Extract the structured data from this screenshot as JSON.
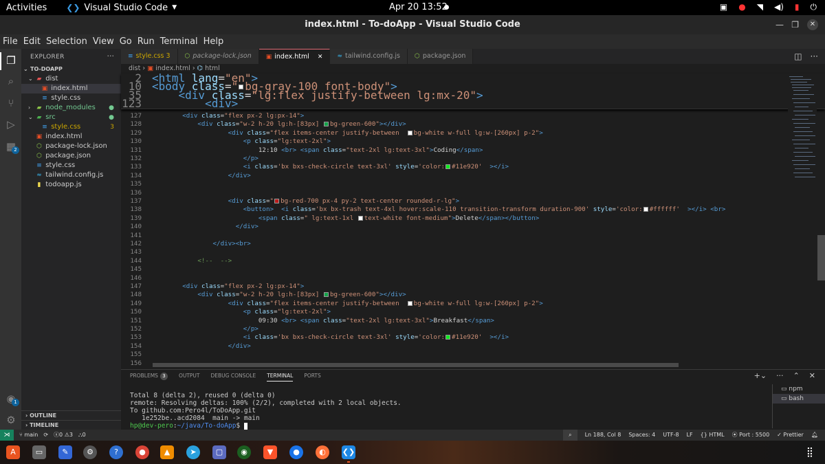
{
  "gnome": {
    "activities": "Activities",
    "app_name": "Visual Studio Code",
    "clock": "Apr 20  13:52"
  },
  "window": {
    "title": "index.html - To-doApp - Visual Studio Code"
  },
  "menu": [
    "File",
    "Edit",
    "Selection",
    "View",
    "Go",
    "Run",
    "Terminal",
    "Help"
  ],
  "activity": {
    "extensions_badge": "2",
    "accounts_badge": "1"
  },
  "sidebar": {
    "header": "EXPLORER",
    "root": "TO-DOAPP",
    "items": [
      {
        "label": "dist",
        "status": ""
      },
      {
        "label": "index.html",
        "status": ""
      },
      {
        "label": "style.css",
        "status": ""
      },
      {
        "label": "node_modules",
        "status": "●"
      },
      {
        "label": "src",
        "status": "●"
      },
      {
        "label": "style.css",
        "status": "3"
      },
      {
        "label": "index.html",
        "status": ""
      },
      {
        "label": "package-lock.json",
        "status": ""
      },
      {
        "label": "package.json",
        "status": ""
      },
      {
        "label": "style.css",
        "status": ""
      },
      {
        "label": "tailwind.config.js",
        "status": ""
      },
      {
        "label": "todoapp.js",
        "status": ""
      }
    ],
    "outline": "OUTLINE",
    "timeline": "TIMELINE"
  },
  "tabs": [
    {
      "label": "style.css 3"
    },
    {
      "label": "package-lock.json"
    },
    {
      "label": "index.html"
    },
    {
      "label": "tailwind.config.js"
    },
    {
      "label": "package.json"
    }
  ],
  "breadcrumb": {
    "a": "dist",
    "b": "index.html",
    "c": "html"
  },
  "sticky": [
    {
      "n": "2",
      "parts": [
        [
          "tg",
          "<html "
        ],
        [
          "at",
          "lang"
        ],
        [
          "eq",
          "="
        ],
        [
          "sv",
          "\"en\""
        ],
        [
          "tg",
          ">"
        ]
      ]
    },
    {
      "n": "10",
      "parts": [
        [
          "tg",
          "<body "
        ],
        [
          "at",
          "class"
        ],
        [
          "eq",
          "="
        ],
        [
          "sv",
          "\""
        ],
        [
          "sw",
          "#ffffff"
        ],
        [
          "sv",
          "bg-gray-100 font-body\""
        ],
        [
          "tg",
          ">"
        ]
      ]
    },
    {
      "n": "35",
      "parts": [
        [
          "tx",
          "    "
        ],
        [
          "tg",
          "<div "
        ],
        [
          "at",
          "class"
        ],
        [
          "eq",
          "="
        ],
        [
          "sv",
          "\"lg:flex justify-between lg:mx-20\""
        ],
        [
          "tg",
          ">"
        ]
      ]
    },
    {
      "n": "123",
      "parts": [
        [
          "tx",
          "        "
        ],
        [
          "tg",
          "<div>"
        ]
      ]
    }
  ],
  "code": [
    {
      "n": "127",
      "parts": [
        [
          "tx",
          "        "
        ],
        [
          "tg",
          "<div "
        ],
        [
          "at",
          "class"
        ],
        [
          "eq",
          "="
        ],
        [
          "sv",
          "\"flex px-2 lg:px-14\""
        ],
        [
          "tg",
          ">"
        ]
      ]
    },
    {
      "n": "128",
      "parts": [
        [
          "tx",
          "            "
        ],
        [
          "tg",
          "<div "
        ],
        [
          "at",
          "class"
        ],
        [
          "eq",
          "="
        ],
        [
          "sv",
          "\"w-2 h-20 lg:h-[83px] "
        ],
        [
          "sw",
          "#16a34a"
        ],
        [
          "sv",
          "bg-green-600\""
        ],
        [
          "tg",
          "></div>"
        ]
      ]
    },
    {
      "n": "129",
      "parts": [
        [
          "tx",
          "                    "
        ],
        [
          "tg",
          "<div "
        ],
        [
          "at",
          "class"
        ],
        [
          "eq",
          "="
        ],
        [
          "sv",
          "\"flex items-center justify-between  "
        ],
        [
          "sw",
          "#ffffff"
        ],
        [
          "sv",
          "bg-white w-full lg:w-[260px] p-2\""
        ],
        [
          "tg",
          ">"
        ]
      ]
    },
    {
      "n": "130",
      "parts": [
        [
          "tx",
          "                        "
        ],
        [
          "tg",
          "<p "
        ],
        [
          "at",
          "class"
        ],
        [
          "eq",
          "="
        ],
        [
          "sv",
          "\"lg:text-2xl\""
        ],
        [
          "tg",
          ">"
        ]
      ]
    },
    {
      "n": "131",
      "parts": [
        [
          "tx",
          "                            12:10 "
        ],
        [
          "tg",
          "<br>"
        ],
        [
          "tx",
          " "
        ],
        [
          "tg",
          "<span "
        ],
        [
          "at",
          "class"
        ],
        [
          "eq",
          "="
        ],
        [
          "sv",
          "\"text-2xl lg:text-3xl\""
        ],
        [
          "tg",
          ">"
        ],
        [
          "tx",
          "Coding"
        ],
        [
          "tg",
          "</span>"
        ]
      ]
    },
    {
      "n": "132",
      "parts": [
        [
          "tx",
          "                        "
        ],
        [
          "tg",
          "</p>"
        ]
      ]
    },
    {
      "n": "133",
      "parts": [
        [
          "tx",
          "                        "
        ],
        [
          "tg",
          "<i "
        ],
        [
          "at",
          "class"
        ],
        [
          "eq",
          "="
        ],
        [
          "sv",
          "'bx bxs-check-circle text-3xl' "
        ],
        [
          "at",
          "style"
        ],
        [
          "eq",
          "="
        ],
        [
          "sv",
          "'color:"
        ],
        [
          "sw",
          "#11e920"
        ],
        [
          "sv",
          "#11e920'"
        ],
        [
          "tx",
          "  "
        ],
        [
          "tg",
          "></i>"
        ]
      ]
    },
    {
      "n": "134",
      "parts": [
        [
          "tx",
          "                    "
        ],
        [
          "tg",
          "</div>"
        ]
      ]
    },
    {
      "n": "135",
      "parts": []
    },
    {
      "n": "136",
      "parts": []
    },
    {
      "n": "137",
      "parts": [
        [
          "tx",
          "                    "
        ],
        [
          "tg",
          "<div "
        ],
        [
          "at",
          "class"
        ],
        [
          "eq",
          "="
        ],
        [
          "sv",
          "\""
        ],
        [
          "sw",
          "#b91c1c"
        ],
        [
          "sv",
          "bg-red-700 px-4 py-2 text-center rounded-r-lg\""
        ],
        [
          "tg",
          ">"
        ]
      ]
    },
    {
      "n": "138",
      "parts": [
        [
          "tx",
          "                        "
        ],
        [
          "tg",
          "<button>"
        ],
        [
          "tx",
          "  "
        ],
        [
          "tg",
          "<i "
        ],
        [
          "at",
          "class"
        ],
        [
          "eq",
          "="
        ],
        [
          "sv",
          "'bx bx-trash text-4xl hover:scale-110 transition-transform duration-900' "
        ],
        [
          "at",
          "style"
        ],
        [
          "eq",
          "="
        ],
        [
          "sv",
          "'color:"
        ],
        [
          "sw",
          "#ffffff"
        ],
        [
          "sv",
          "#ffffff'"
        ],
        [
          "tx",
          "  "
        ],
        [
          "tg",
          "></i>"
        ],
        [
          "tx",
          " "
        ],
        [
          "tg",
          "<br>"
        ]
      ]
    },
    {
      "n": "139",
      "parts": [
        [
          "tx",
          "                            "
        ],
        [
          "tg",
          "<span "
        ],
        [
          "at",
          "class"
        ],
        [
          "eq",
          "="
        ],
        [
          "sv",
          "\" lg:text-1xl "
        ],
        [
          "sw",
          "#ffffff"
        ],
        [
          "sv",
          "text-white font-medium\""
        ],
        [
          "tg",
          ">"
        ],
        [
          "tx",
          "Delete"
        ],
        [
          "tg",
          "</span></button>"
        ]
      ]
    },
    {
      "n": "140",
      "parts": [
        [
          "tx",
          "                      "
        ],
        [
          "tg",
          "</div>"
        ]
      ]
    },
    {
      "n": "141",
      "parts": []
    },
    {
      "n": "142",
      "parts": [
        [
          "tx",
          "                "
        ],
        [
          "tg",
          "</div><br>"
        ]
      ]
    },
    {
      "n": "143",
      "parts": []
    },
    {
      "n": "144",
      "parts": [
        [
          "tx",
          "            "
        ],
        [
          "cm",
          "<!--  -->"
        ]
      ]
    },
    {
      "n": "145",
      "parts": []
    },
    {
      "n": "146",
      "parts": []
    },
    {
      "n": "147",
      "parts": [
        [
          "tx",
          "        "
        ],
        [
          "tg",
          "<div "
        ],
        [
          "at",
          "class"
        ],
        [
          "eq",
          "="
        ],
        [
          "sv",
          "\"flex px-2 lg:px-14\""
        ],
        [
          "tg",
          ">"
        ]
      ]
    },
    {
      "n": "148",
      "parts": [
        [
          "tx",
          "            "
        ],
        [
          "tg",
          "<div "
        ],
        [
          "at",
          "class"
        ],
        [
          "eq",
          "="
        ],
        [
          "sv",
          "\"w-2 h-20 lg:h-[83px] "
        ],
        [
          "sw",
          "#16a34a"
        ],
        [
          "sv",
          "bg-green-600\""
        ],
        [
          "tg",
          "></div>"
        ]
      ]
    },
    {
      "n": "149",
      "parts": [
        [
          "tx",
          "                    "
        ],
        [
          "tg",
          "<div "
        ],
        [
          "at",
          "class"
        ],
        [
          "eq",
          "="
        ],
        [
          "sv",
          "\"flex items-center justify-between  "
        ],
        [
          "sw",
          "#ffffff"
        ],
        [
          "sv",
          "bg-white w-full lg:w-[260px] p-2\""
        ],
        [
          "tg",
          ">"
        ]
      ]
    },
    {
      "n": "150",
      "parts": [
        [
          "tx",
          "                        "
        ],
        [
          "tg",
          "<p "
        ],
        [
          "at",
          "class"
        ],
        [
          "eq",
          "="
        ],
        [
          "sv",
          "\"lg:text-2xl\""
        ],
        [
          "tg",
          ">"
        ]
      ]
    },
    {
      "n": "151",
      "parts": [
        [
          "tx",
          "                            09:30 "
        ],
        [
          "tg",
          "<br>"
        ],
        [
          "tx",
          " "
        ],
        [
          "tg",
          "<span "
        ],
        [
          "at",
          "class"
        ],
        [
          "eq",
          "="
        ],
        [
          "sv",
          "\"text-2xl lg:text-3xl\""
        ],
        [
          "tg",
          ">"
        ],
        [
          "tx",
          "Breakfast"
        ],
        [
          "tg",
          "</span>"
        ]
      ]
    },
    {
      "n": "152",
      "parts": [
        [
          "tx",
          "                        "
        ],
        [
          "tg",
          "</p>"
        ]
      ]
    },
    {
      "n": "153",
      "parts": [
        [
          "tx",
          "                        "
        ],
        [
          "tg",
          "<i "
        ],
        [
          "at",
          "class"
        ],
        [
          "eq",
          "="
        ],
        [
          "sv",
          "'bx bxs-check-circle text-3xl' "
        ],
        [
          "at",
          "style"
        ],
        [
          "eq",
          "="
        ],
        [
          "sv",
          "'color:"
        ],
        [
          "sw",
          "#11e920"
        ],
        [
          "sv",
          "#11e920'"
        ],
        [
          "tx",
          "  "
        ],
        [
          "tg",
          "></i>"
        ]
      ]
    },
    {
      "n": "154",
      "parts": [
        [
          "tx",
          "                    "
        ],
        [
          "tg",
          "</div>"
        ]
      ]
    },
    {
      "n": "155",
      "parts": []
    },
    {
      "n": "156",
      "parts": []
    }
  ],
  "panel": {
    "tabs": {
      "problems": "PROBLEMS",
      "problems_count": "3",
      "output": "OUTPUT",
      "debug": "DEBUG CONSOLE",
      "terminal": "TERMINAL",
      "ports": "PORTS"
    },
    "terminal_lines": [
      "Total 8 (delta 2), reused 0 (delta 0)",
      "remote: Resolving deltas: 100% (2/2), completed with 2 local objects.",
      "To github.com:Pero4l/ToDoApp.git",
      "   1e252be..acd2084  main -> main"
    ],
    "prompt_user": "hp@dev-pero",
    "prompt_sep": ":",
    "prompt_path": "~/java/To-doApp",
    "prompt_end": "$ ",
    "terminals": [
      "npm",
      "bash"
    ]
  },
  "status": {
    "branch": "main",
    "errors": "0",
    "warnings": "3",
    "ports_count": "0",
    "position": "Ln 188, Col 8",
    "spaces": "Spaces: 4",
    "encoding": "UTF-8",
    "eol": "LF",
    "language": "HTML",
    "port": "Port : 5500",
    "formatter": "Prettier"
  },
  "colors": {
    "accent": "#0e639c",
    "active_tab_top": "#e06c75",
    "remote": "#16825d"
  }
}
